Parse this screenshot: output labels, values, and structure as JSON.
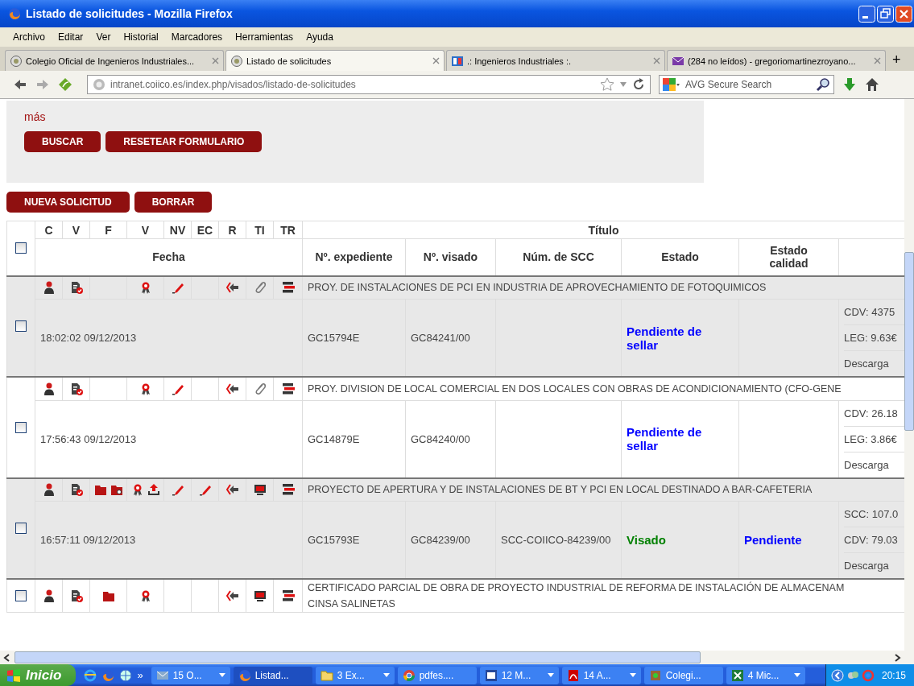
{
  "window": {
    "title": "Listado de solicitudes - Mozilla Firefox"
  },
  "menu": [
    "Archivo",
    "Editar",
    "Ver",
    "Historial",
    "Marcadores",
    "Herramientas",
    "Ayuda"
  ],
  "tabs": [
    {
      "label": "Colegio Oficial de Ingenieros Industriales...",
      "kind": "seal",
      "selected": false
    },
    {
      "label": "Listado de solicitudes",
      "kind": "seal",
      "selected": true
    },
    {
      "label": ".: Ingenieros Industriales :.",
      "kind": "book",
      "selected": false
    },
    {
      "label": "(284 no leídos) - gregoriomartinezroyano...",
      "kind": "mail",
      "selected": false
    }
  ],
  "new_tab": "+",
  "address": {
    "url": "intranet.coiico.es/index.php/visados/listado-de-solicitudes"
  },
  "search": {
    "placeholder": "AVG Secure Search"
  },
  "filter_panel": {
    "more_link": "más",
    "buttons": [
      "BUSCAR",
      "RESETEAR FORMULARIO"
    ]
  },
  "actions": [
    "NUEVA SOLICITUD",
    "BORRAR"
  ],
  "table": {
    "select_all": {
      "checked": false
    },
    "icon_columns": [
      "C",
      "V",
      "F",
      "V",
      "NV",
      "EC",
      "R",
      "TI",
      "TR"
    ],
    "title_header": "Título",
    "columns": [
      "Fecha",
      "Nº. expediente",
      "Nº. visado",
      "Núm. de SCC",
      "Estado",
      "Estado calidad"
    ],
    "rows": [
      {
        "checked": false,
        "icons": [
          {
            "kind": "person"
          },
          {
            "kind": "doc-check"
          },
          {
            "kind": "none"
          },
          {
            "kind": "award"
          },
          {
            "kind": "pencil"
          },
          {
            "kind": "none"
          },
          {
            "kind": "back"
          },
          {
            "kind": "clip"
          },
          {
            "kind": "stack"
          }
        ],
        "title_lines": [
          "PROY. DE INSTALACIONES DE PCI EN INDUSTRIA DE APROVECHAMIENTO DE FOTOQUIMICOS"
        ],
        "fecha": "18:02:02 09/12/2013",
        "expediente": "GC15794E",
        "visado": "GC84241/00",
        "estado": {
          "text": "Pendiente de sellar",
          "color": "#0000ff"
        },
        "fees": [
          "CDV: 4375",
          "LEG: 9.63€",
          "Descarga"
        ]
      },
      {
        "checked": false,
        "icons": [
          {
            "kind": "person"
          },
          {
            "kind": "doc-check"
          },
          {
            "kind": "none"
          },
          {
            "kind": "award"
          },
          {
            "kind": "pencil"
          },
          {
            "kind": "none"
          },
          {
            "kind": "back"
          },
          {
            "kind": "clip"
          },
          {
            "kind": "stack"
          }
        ],
        "title_lines": [
          "PROY. DIVISION DE LOCAL COMERCIAL EN DOS LOCALES CON OBRAS DE ACONDICIONAMIENTO (CFO-GENE"
        ],
        "fecha": "17:56:43 09/12/2013",
        "expediente": "GC14879E",
        "visado": "GC84240/00",
        "estado": {
          "text": "Pendiente de sellar",
          "color": "#0000ff"
        },
        "fees": [
          "CDV: 26.18",
          "LEG: 3.86€",
          "Descarga"
        ]
      },
      {
        "checked": false,
        "icons": [
          {
            "kind": "person"
          },
          {
            "kind": "doc-check"
          },
          {
            "kind": "folders"
          },
          {
            "kind": "award-upload"
          },
          {
            "kind": "pencil"
          },
          {
            "kind": "pencil"
          },
          {
            "kind": "back"
          },
          {
            "kind": "monitor"
          },
          {
            "kind": "stack"
          }
        ],
        "title_lines": [
          "PROYECTO DE APERTURA Y DE INSTALACIONES DE BT Y PCI EN LOCAL DESTINADO A BAR-CAFETERIA"
        ],
        "fecha": "16:57:11 09/12/2013",
        "expediente": "GC15793E",
        "visado": "GC84239/00",
        "scc": "SCC-COIICO-84239/00",
        "estado": {
          "text": "Visado",
          "color": "#008000"
        },
        "calidad": {
          "text": "Pendiente",
          "color": "#0000ff"
        },
        "fees": [
          "SCC: 107.0",
          "CDV: 79.03",
          "Descarga"
        ]
      },
      {
        "checked": false,
        "icons": [
          {
            "kind": "person"
          },
          {
            "kind": "doc-check"
          },
          {
            "kind": "folder"
          },
          {
            "kind": "award"
          },
          {
            "kind": "none"
          },
          {
            "kind": "none"
          },
          {
            "kind": "back"
          },
          {
            "kind": "monitor"
          },
          {
            "kind": "stack"
          }
        ],
        "title_lines": [
          "CERTIFICADO PARCIAL DE OBRA DE PROYECTO INDUSTRIAL DE REFORMA DE INSTALACIÓN DE ALMACENAM",
          "CINSA SALINETAS"
        ]
      }
    ]
  },
  "taskbar": {
    "start": "Inicio",
    "more": "»",
    "tasks": [
      {
        "label": "15 O...",
        "kind": "mail",
        "menu": true,
        "selected": false
      },
      {
        "label": "Listad...",
        "kind": "firefox",
        "menu": false,
        "selected": true
      },
      {
        "label": "3 Ex...",
        "kind": "folder",
        "menu": true,
        "selected": false
      },
      {
        "label": "pdfes....",
        "kind": "chrome",
        "menu": false,
        "selected": false
      },
      {
        "label": "12 M...",
        "kind": "word",
        "menu": true,
        "selected": false
      },
      {
        "label": "14 A...",
        "kind": "pdf",
        "menu": true,
        "selected": false
      },
      {
        "label": "Colegi...",
        "kind": "app",
        "menu": false,
        "selected": false
      },
      {
        "label": "4 Mic...",
        "kind": "excel",
        "menu": true,
        "selected": false
      }
    ],
    "clock": "20:15"
  }
}
